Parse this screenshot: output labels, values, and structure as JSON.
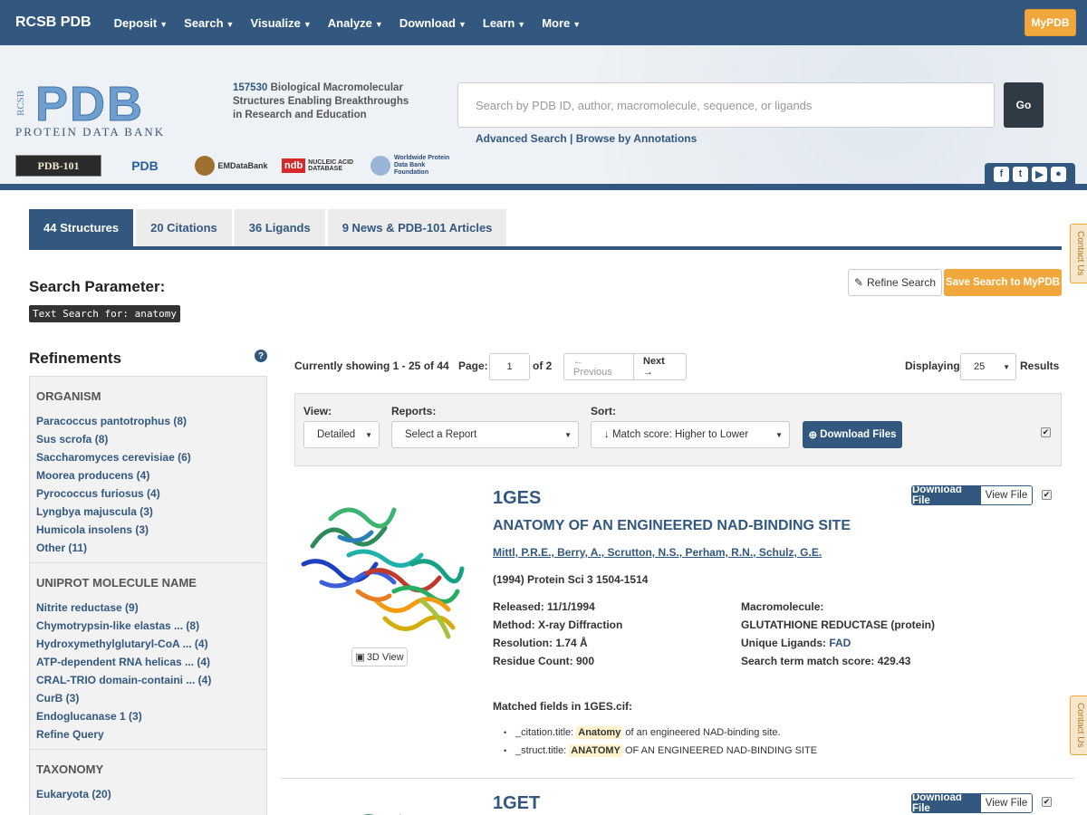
{
  "nav": {
    "brand": "RCSB PDB",
    "items": [
      "Deposit",
      "Search",
      "Visualize",
      "Analyze",
      "Download",
      "Learn",
      "More"
    ],
    "mypdb": "MyPDB"
  },
  "header": {
    "logo_side": "RCSB",
    "logo_main": "PDB",
    "logo_sub": "PROTEIN DATA BANK",
    "count": "157530",
    "tagline": " Biological Macromolecular Structures Enabling Breakthroughs in Research and Education",
    "search_placeholder": "Search by PDB ID, author, macromolecule, sequence, or ligands",
    "go": "Go",
    "advanced_links": "Advanced Search | Browse by Annotations",
    "partners": [
      "PDB-101",
      "PDB",
      "EMDataBank",
      "NUCLEIC ACID DATABASE",
      "Worldwide Protein Data Bank Foundation"
    ],
    "social_icons": [
      "facebook-icon",
      "twitter-icon",
      "youtube-icon",
      "github-icon"
    ]
  },
  "tabs": [
    "44 Structures",
    "20 Citations",
    "36 Ligands",
    "9 News & PDB-101 Articles"
  ],
  "contact": "Contact Us",
  "search_param": {
    "title": "Search Parameter:",
    "chip": "Text Search for: anatomy",
    "refine": "Refine Search",
    "save": "Save Search to MyPDB"
  },
  "refinements": {
    "title": "Refinements",
    "sections": [
      {
        "head": "ORGANISM",
        "items": [
          "Paracoccus pantotrophus (8)",
          "Sus scrofa (8)",
          "Saccharomyces cerevisiae (6)",
          "Moorea producens (4)",
          "Pyrococcus furiosus (4)",
          "Lyngbya majuscula (3)",
          "Humicola insolens (3)",
          "Other (11)"
        ]
      },
      {
        "head": "UNIPROT MOLECULE NAME",
        "items": [
          "Nitrite reductase (9)",
          "Chymotrypsin-like elastas ... (8)",
          "Hydroxymethylglutaryl-CoA ... (4)",
          "ATP-dependent RNA helicas ... (4)",
          "CRAL-TRIO domain-containi ... (4)",
          "CurB (3)",
          "Endoglucanase 1 (3)",
          "Refine Query"
        ]
      },
      {
        "head": "TAXONOMY",
        "items": [
          "Eukaryota (20)"
        ]
      }
    ]
  },
  "toolbar": {
    "showing": "Currently showing 1 - 25 of 44",
    "page_label": "Page:",
    "page_value": "1",
    "of": "of 2",
    "prev": "← Previous",
    "next": "Next →",
    "displaying": "Displaying",
    "display_value": "25",
    "results": "Results"
  },
  "options": {
    "view_label": "View:",
    "view_value": "Detailed",
    "reports_label": "Reports:",
    "reports_value": "Select a Report",
    "sort_label": "Sort:",
    "sort_value": "↓ Match score: Higher to Lower",
    "download_files": "Download Files"
  },
  "entries": [
    {
      "id": "1GES",
      "title": "ANATOMY OF AN ENGINEERED NAD-BINDING SITE",
      "authors": "Mittl, P.R.E., Berry, A., Scrutton, N.S., Perham, R.N., Schulz, G.E.",
      "citation": "(1994) Protein Sci 3 1504-1514",
      "released": "Released: 11/1/1994",
      "method": "Method: X-ray Diffraction",
      "resolution": "Resolution: 1.74 Å",
      "residue_count": "Residue Count: 900",
      "macromolecule_label": "Macromolecule:",
      "macromolecule": "GLUTATHIONE REDUCTASE (protein)",
      "ligands_label": "Unique Ligands: ",
      "ligands": "FAD",
      "score": "Search term match score: 429.43",
      "matched_title": "Matched fields in 1GES.cif:",
      "matched": [
        {
          "field": "_citation.title: ",
          "hl": "Anatomy",
          "rest": " of an engineered NAD-binding site."
        },
        {
          "field": "_struct.title: ",
          "hl": "ANATOMY",
          "rest": " OF AN ENGINEERED NAD-BINDING SITE"
        }
      ],
      "view3d": "3D View"
    },
    {
      "id": "1GET"
    }
  ],
  "entry_buttons": {
    "download": "Download File",
    "view": "View File"
  }
}
